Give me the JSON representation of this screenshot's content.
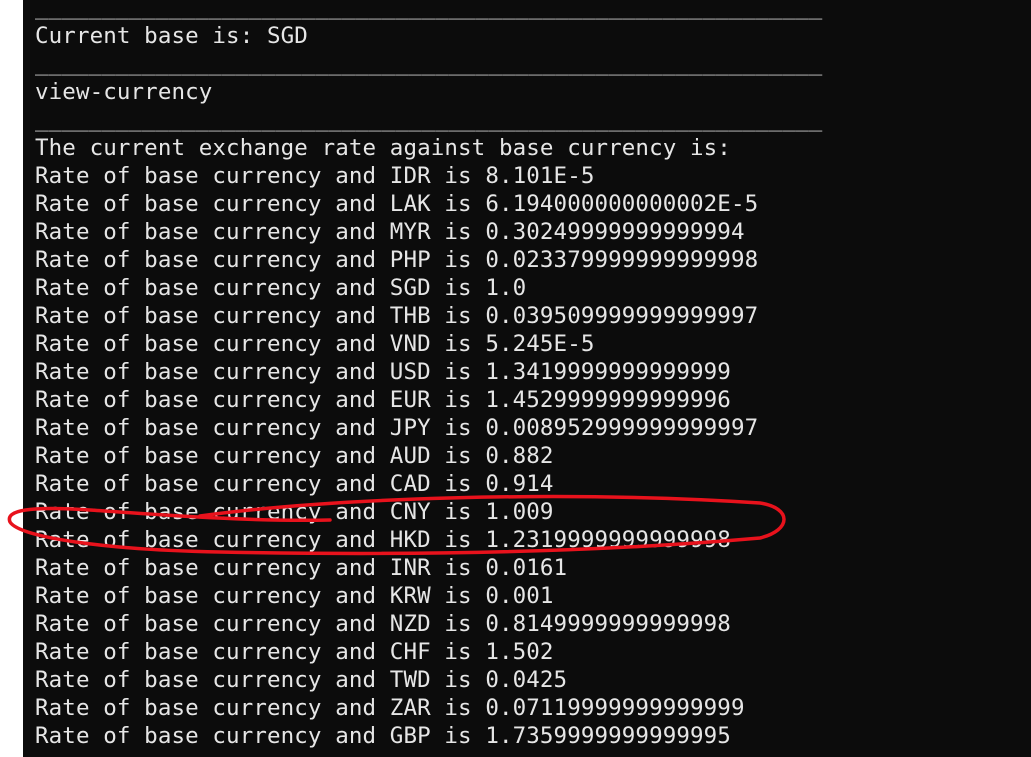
{
  "terminal": {
    "lines": [
      {
        "kind": "sep",
        "text": "___________________________________________________________"
      },
      {
        "kind": "text",
        "text": "Current base is: SGD"
      },
      {
        "kind": "sep",
        "text": "___________________________________________________________"
      },
      {
        "kind": "text",
        "text": "view-currency"
      },
      {
        "kind": "sep",
        "text": "___________________________________________________________"
      },
      {
        "kind": "text",
        "text": "The current exchange rate against base currency is:"
      },
      {
        "kind": "text",
        "text": "Rate of base currency and IDR is 8.101E-5"
      },
      {
        "kind": "text",
        "text": "Rate of base currency and LAK is 6.194000000000002E-5"
      },
      {
        "kind": "text",
        "text": "Rate of base currency and MYR is 0.30249999999999994"
      },
      {
        "kind": "text",
        "text": "Rate of base currency and PHP is 0.023379999999999998"
      },
      {
        "kind": "text",
        "text": "Rate of base currency and SGD is 1.0"
      },
      {
        "kind": "text",
        "text": "Rate of base currency and THB is 0.039509999999999997"
      },
      {
        "kind": "text",
        "text": "Rate of base currency and VND is 5.245E-5"
      },
      {
        "kind": "text",
        "text": "Rate of base currency and USD is 1.3419999999999999"
      },
      {
        "kind": "text",
        "text": "Rate of base currency and EUR is 1.4529999999999996"
      },
      {
        "kind": "text",
        "text": "Rate of base currency and JPY is 0.008952999999999997"
      },
      {
        "kind": "text",
        "text": "Rate of base currency and AUD is 0.882"
      },
      {
        "kind": "text",
        "text": "Rate of base currency and CAD is 0.914"
      },
      {
        "kind": "text",
        "text": "Rate of base currency and CNY is 1.009"
      },
      {
        "kind": "text",
        "text": "Rate of base currency and HKD is 1.2319999999999998"
      },
      {
        "kind": "text",
        "text": "Rate of base currency and INR is 0.0161"
      },
      {
        "kind": "text",
        "text": "Rate of base currency and KRW is 0.001"
      },
      {
        "kind": "text",
        "text": "Rate of base currency and NZD is 0.8149999999999998"
      },
      {
        "kind": "text",
        "text": "Rate of base currency and CHF is 1.502"
      },
      {
        "kind": "text",
        "text": "Rate of base currency and TWD is 0.0425"
      },
      {
        "kind": "text",
        "text": "Rate of base currency and ZAR is 0.07119999999999999"
      },
      {
        "kind": "text",
        "text": "Rate of base currency and GBP is 1.7359999999999995"
      }
    ]
  },
  "annotation": {
    "color": "#e8121c",
    "highlighted_line": "Rate of base currency and HKD is 1.2319999999999998"
  },
  "colors": {
    "background": "#0c0c0c",
    "text": "#e6e6e6"
  }
}
